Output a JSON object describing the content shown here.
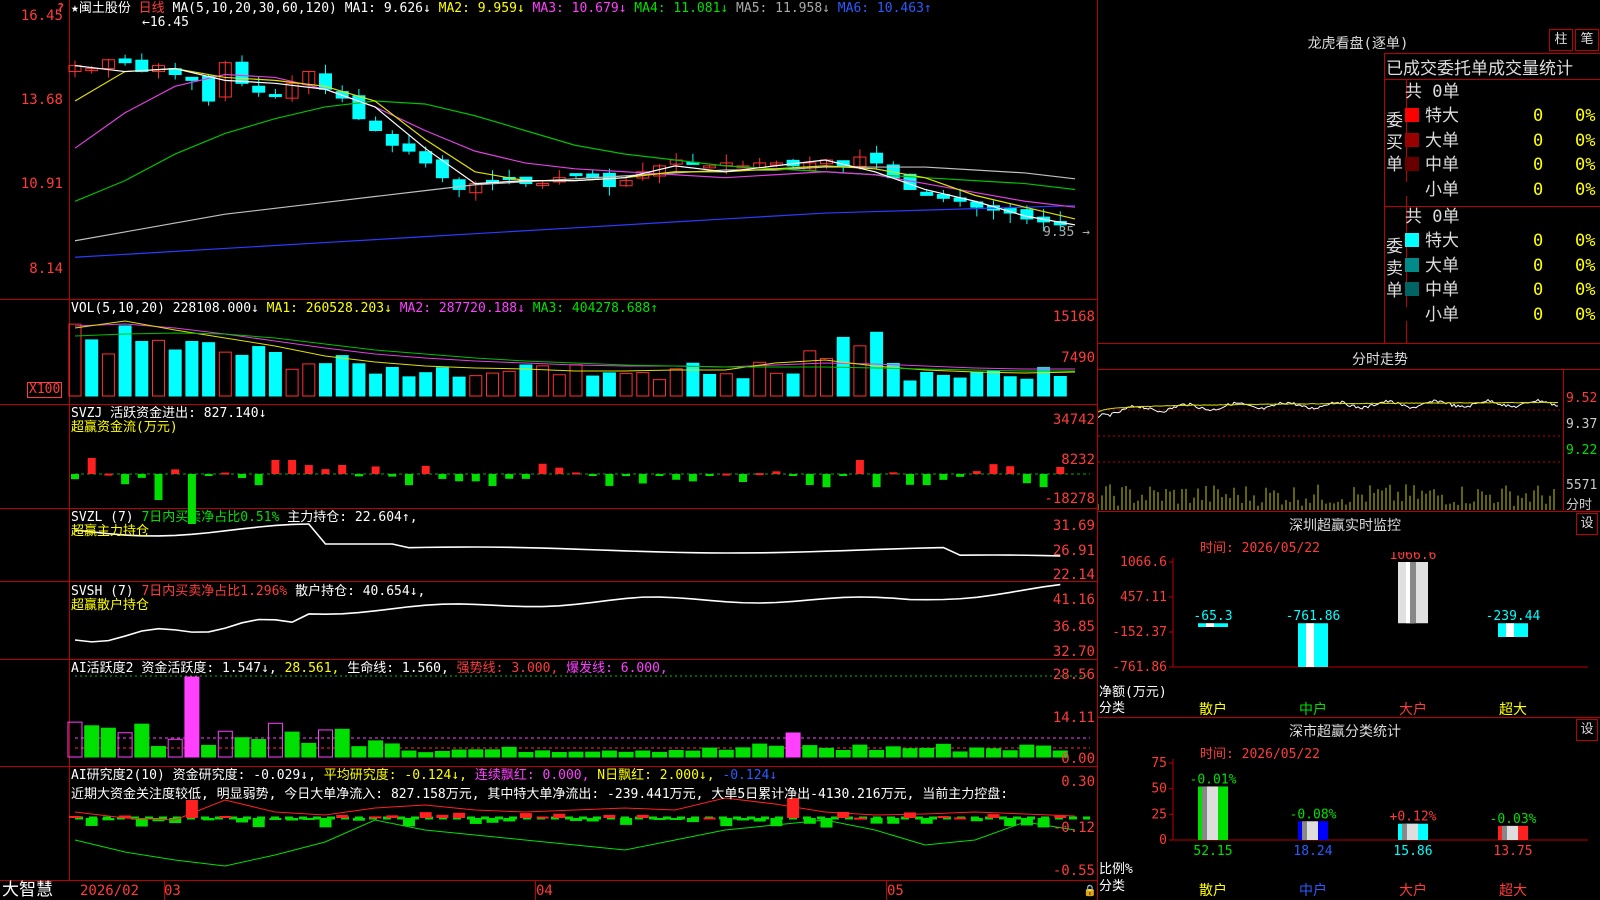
{
  "app": {
    "logo": "大智慧",
    "lock": "🔒"
  },
  "stock": {
    "title": "★闽土股份",
    "period": "日线"
  },
  "kline": {
    "ma_params": "MA(5,10,20,30,60,120)",
    "ma1": "MA1: 9.626↓",
    "ma2": "MA2: 9.959↓",
    "ma3": "MA3: 10.679↓",
    "ma4": "MA4: 11.081↓",
    "ma5": "MA5: 11.958↓",
    "ma6": "MA6: 10.463↑",
    "high_mark": "16.45",
    "low_mark": "9.35",
    "yaxis": [
      "16.45",
      "13.68",
      "10.91",
      "8.14"
    ],
    "x_labels": [
      "2026/02",
      "03",
      "04",
      "05"
    ]
  },
  "vol": {
    "params": "VOL(5,10,20)",
    "v": "228108.000↓",
    "ma1": "MA1: 260528.203↓",
    "ma2": "MA2: 287720.188↓",
    "ma3": "MA3: 404278.688↑",
    "yaxis": [
      "15168",
      "7490",
      "X100"
    ]
  },
  "svzj": {
    "name": "SVZJ",
    "label": "活跃资金进出: 827.140↓",
    "sub": "超赢资金流(万元)",
    "yaxis": [
      "34742",
      "8232",
      "-18278"
    ]
  },
  "svzl": {
    "name": "SVZL (7)",
    "label": "7日内买卖净占比0.51%",
    "label2": "主力持仓: 22.604↑,",
    "sub": "超赢主力持仓",
    "yaxis": [
      "31.69",
      "26.91",
      "22.14"
    ]
  },
  "svsh": {
    "name": "SVSH (7)",
    "label": "7日内买卖净占比1.296%",
    "label2": "散户持仓: 40.654↓,",
    "sub": "超赢散户持仓",
    "yaxis": [
      "41.16",
      "36.85",
      "32.70"
    ]
  },
  "ai1": {
    "name": "AI活跃度2",
    "a": "资金活跃度: 1.547↓,",
    "b": "28.561,",
    "c": "生命线: 1.560,",
    "d": "强势线: 3.000,",
    "e": "爆发线: 6.000,",
    "yaxis": [
      "28.56",
      "14.11",
      "0.00"
    ]
  },
  "ai2": {
    "name": "AI研究度2(10)",
    "a": "资金研究度: -0.029↓,",
    "b": "平均研究度: -0.124↓,",
    "c": "连续飘红: 0.000,",
    "d": "N日飘红: 2.000↓,",
    "e": "-0.124↓",
    "text": "近期大资金关注度较低, 明显弱势, 今日大单净流入: 827.158万元, 其中特大单净流出: -239.441万元, 大单5日累计净出-4130.216万元, 当前主力控盘: ",
    "yaxis": [
      "0.30",
      "-0.12",
      "-0.55"
    ]
  },
  "dragon": {
    "title": "龙虎看盘(逐单)",
    "btn1": "柱",
    "btn2": "笔",
    "header": "已成交委托单成交量统计",
    "buy": {
      "label": "委买单",
      "total": "共 0单",
      "rows": [
        {
          "name": "特大",
          "v": "0",
          "p": "0%",
          "c": "#ff0000"
        },
        {
          "name": "大单",
          "v": "0",
          "p": "0%",
          "c": "#990000"
        },
        {
          "name": "中单",
          "v": "0",
          "p": "0%",
          "c": "#660000"
        },
        {
          "name": "小单",
          "v": "0",
          "p": "0%",
          "c": "#000000"
        }
      ]
    },
    "sell": {
      "label": "委卖单",
      "total": "共 0单",
      "rows": [
        {
          "name": "特大",
          "v": "0",
          "p": "0%",
          "c": "#00ffff"
        },
        {
          "name": "大单",
          "v": "0",
          "p": "0%",
          "c": "#008a8a"
        },
        {
          "name": "中单",
          "v": "0",
          "p": "0%",
          "c": "#006464"
        },
        {
          "name": "小单",
          "v": "0",
          "p": "0%",
          "c": "#000000"
        }
      ]
    }
  },
  "minute": {
    "title": "分时走势",
    "yaxis": [
      "9.52",
      "9.37",
      "9.22"
    ],
    "vol": "5571",
    "vol_unit": "分时"
  },
  "monitor": {
    "title": "深圳超赢实时监控",
    "btn": "设",
    "time": "时间: 2026/05/22",
    "ylab": "净额(万元)",
    "cat_lab": "分类",
    "yaxis": [
      "1066.6",
      "457.11",
      "-152.37",
      "-761.86"
    ],
    "cats": [
      "散户",
      "中户",
      "大户",
      "超大"
    ],
    "values": [
      -65.3,
      -761.86,
      1066.6,
      -239.44
    ],
    "labels": [
      "-65.3",
      "-761.86",
      "1066.6",
      "-239.44"
    ]
  },
  "classify": {
    "title": "深市超赢分类统计",
    "btn": "设",
    "time": "时间: 2026/05/22",
    "ylab": "比例%",
    "cat_lab": "分类",
    "yaxis": [
      "75",
      "50",
      "25",
      "0"
    ],
    "cats": [
      "散户",
      "中户",
      "大户",
      "超大"
    ],
    "values": [
      52.15,
      18.24,
      15.86,
      13.75
    ],
    "labels": [
      "52.15",
      "18.24",
      "15.86",
      "13.75"
    ],
    "changes": [
      "-0.01%",
      "-0.08%",
      "+0.12%",
      "-0.03%"
    ]
  },
  "chart_data": [
    {
      "type": "bar",
      "title": "深圳超赢实时监控",
      "ylabel": "净额(万元)",
      "categories": [
        "散户",
        "中户",
        "大户",
        "超大"
      ],
      "values": [
        -65.3,
        -761.86,
        1066.6,
        -239.44
      ],
      "ylim": [
        -761.86,
        1066.6
      ]
    },
    {
      "type": "bar",
      "title": "深市超赢分类统计",
      "ylabel": "比例%",
      "categories": [
        "散户",
        "中户",
        "大户",
        "超大"
      ],
      "values": [
        52.15,
        18.24,
        15.86,
        13.75
      ],
      "ylim": [
        0,
        75
      ]
    }
  ]
}
